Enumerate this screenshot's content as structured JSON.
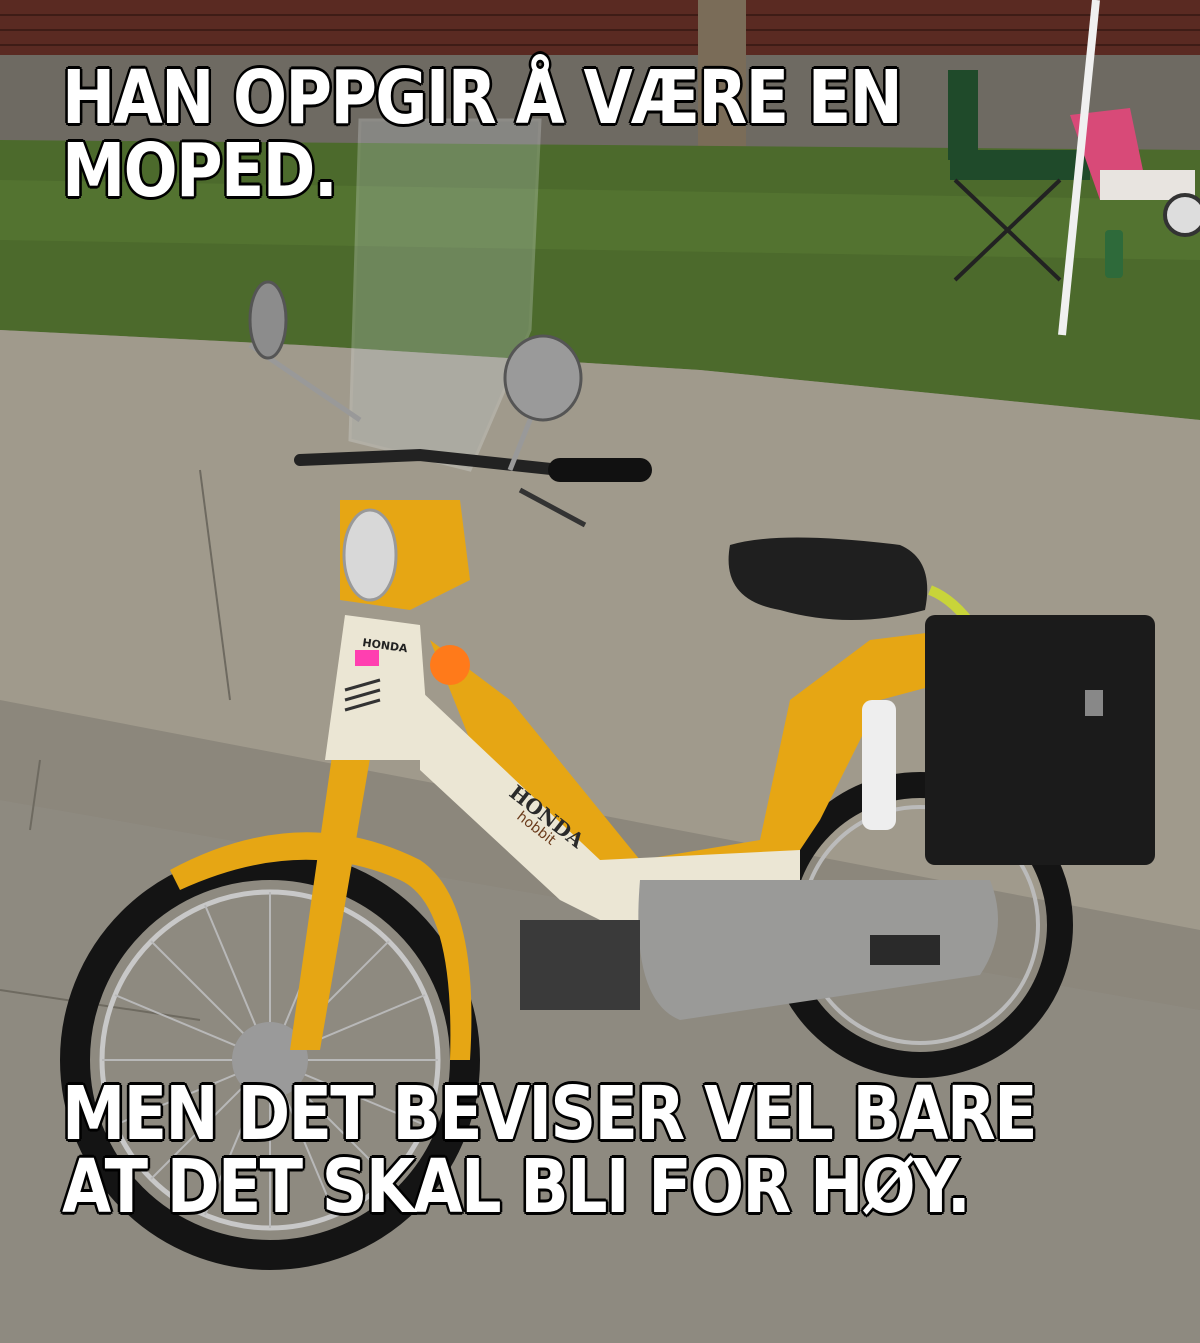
{
  "meme": {
    "top_lines": [
      "HAN OPPGIR Å VÆRE EN",
      "MOPED."
    ],
    "bottom_lines": [
      "MEN DET BEVISER VEL BARE",
      "AT DET SKAL BLI FOR HØY."
    ]
  },
  "photo": {
    "badge_text": "HONDA",
    "tank_logo": "HONDA",
    "tank_model": "hobbit",
    "colors": {
      "frame_yellow": "#e6a614",
      "grass": "#4c6a2c",
      "sidewalk": "#a09a8c",
      "brick": "#5a2a22",
      "bag_black": "#1b1b1b"
    }
  }
}
